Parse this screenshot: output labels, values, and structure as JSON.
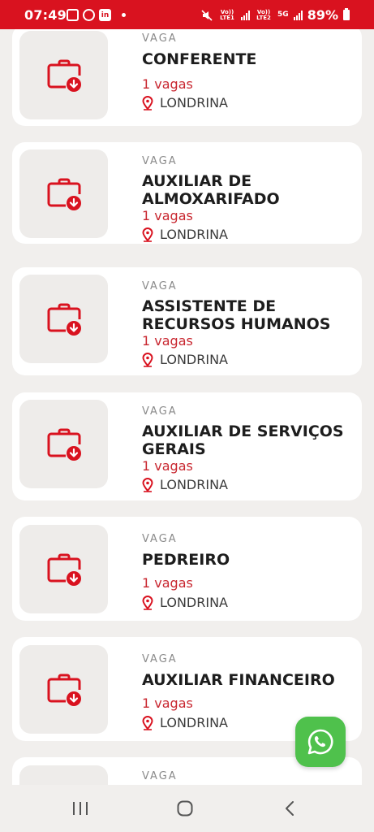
{
  "status": {
    "time": "07:49",
    "battery": "89%",
    "sim1": "Vo)) LTE1",
    "sim2": "Vo)) LTE2",
    "network": "5G",
    "icons": [
      "gallery-icon",
      "whatsapp-notification-icon",
      "linkedin-icon",
      "dot-icon",
      "mute-icon",
      "signal-icon",
      "battery-icon"
    ]
  },
  "jobs": [
    {
      "tag": "VAGA",
      "title": "CONFERENTE",
      "count": "1 vagas",
      "location": "LONDRINA"
    },
    {
      "tag": "VAGA",
      "title": "AUXILIAR DE ALMOXARIFADO",
      "count": "1 vagas",
      "location": "LONDRINA"
    },
    {
      "tag": "VAGA",
      "title": "ASSISTENTE DE RECURSOS HUMANOS",
      "count": "1 vagas",
      "location": "LONDRINA"
    },
    {
      "tag": "VAGA",
      "title": "AUXILIAR DE SERVIÇOS GERAIS",
      "count": "1 vagas",
      "location": "LONDRINA"
    },
    {
      "tag": "VAGA",
      "title": "PEDREIRO",
      "count": "1 vagas",
      "location": "LONDRINA"
    },
    {
      "tag": "VAGA",
      "title": "AUXILIAR FINANCEIRO",
      "count": "1 vagas",
      "location": "LONDRINA"
    },
    {
      "tag": "VAGA",
      "title": "",
      "count": "",
      "location": ""
    }
  ],
  "colors": {
    "brand": "#d9121f",
    "accent": "#c8262f",
    "whatsapp": "#4fc14c",
    "background": "#f1efed"
  },
  "fab": {
    "icon": "whatsapp-icon"
  },
  "nav": {
    "icons": [
      "recent-apps-icon",
      "home-icon",
      "back-icon"
    ]
  }
}
